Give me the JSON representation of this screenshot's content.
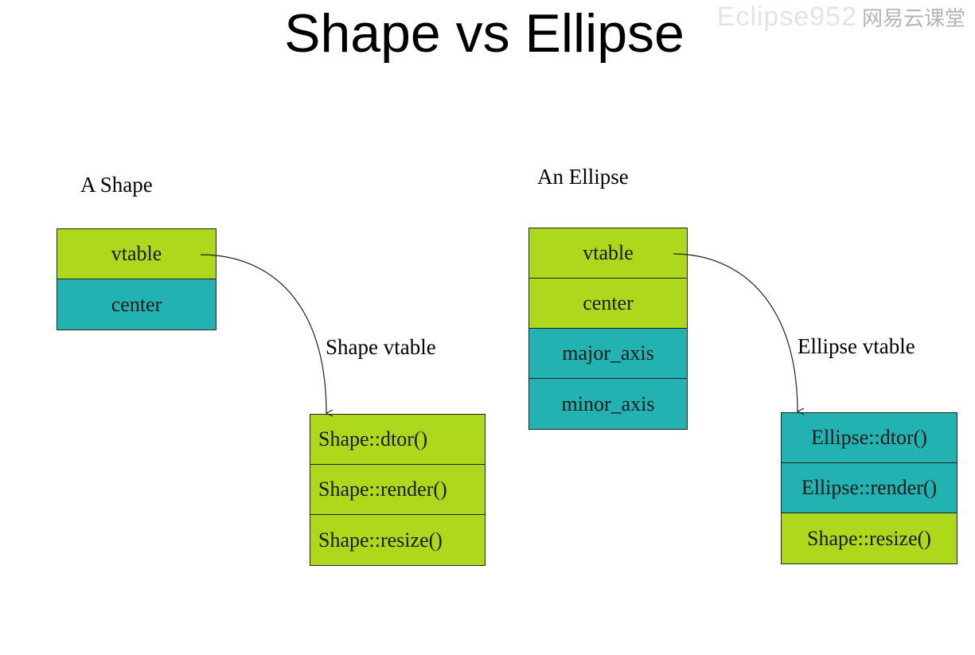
{
  "title": "Shape vs Ellipse",
  "watermark": {
    "text": "Eclipse952",
    "logo_text": "网易云课堂"
  },
  "shape_object": {
    "label": "A Shape",
    "fields": [
      {
        "name": "vtable",
        "color": "#add81c"
      },
      {
        "name": "center",
        "color": "#22b2b2"
      }
    ]
  },
  "shape_vtable": {
    "label": "Shape vtable",
    "entries": [
      {
        "name": "Shape::dtor()",
        "color": "#add81c"
      },
      {
        "name": "Shape::render()",
        "color": "#add81c"
      },
      {
        "name": "Shape::resize()",
        "color": "#add81c"
      }
    ]
  },
  "ellipse_object": {
    "label": "An Ellipse",
    "fields": [
      {
        "name": "vtable",
        "color": "#add81c"
      },
      {
        "name": "center",
        "color": "#add81c"
      },
      {
        "name": "major_axis",
        "color": "#22b2b2"
      },
      {
        "name": "minor_axis",
        "color": "#22b2b2"
      }
    ]
  },
  "ellipse_vtable": {
    "label": "Ellipse vtable",
    "entries": [
      {
        "name": "Ellipse::dtor()",
        "color": "#22b2b2"
      },
      {
        "name": "Ellipse::render()",
        "color": "#22b2b2"
      },
      {
        "name": "Shape::resize()",
        "color": "#add81c"
      }
    ]
  }
}
